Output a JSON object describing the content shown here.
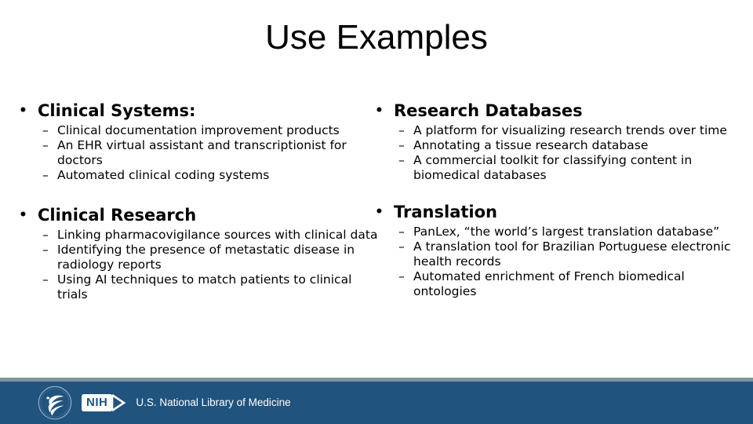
{
  "slide": {
    "title": "Use Examples",
    "background_color": "#ffffff",
    "text_color": "#000000"
  },
  "bullets": {
    "level1_marker": "•",
    "level2_marker": "–"
  },
  "left_column": {
    "groups": [
      {
        "heading": "Clinical Systems:",
        "items": [
          "Clinical documentation improvement products",
          "An EHR virtual assistant and transcriptionist for doctors",
          "Automated clinical coding systems"
        ]
      },
      {
        "heading": "Clinical Research",
        "items": [
          "Linking pharmacovigilance sources with clinical data",
          "Identifying the presence of metastatic disease in radiology reports",
          "Using AI techniques to match patients to clinical trials"
        ]
      }
    ]
  },
  "right_column": {
    "groups": [
      {
        "heading": "Research Databases",
        "items": [
          "A platform for visualizing research trends over time",
          "Annotating a tissue research database",
          "A commercial toolkit for classifying content in biomedical databases"
        ]
      },
      {
        "heading": "Translation",
        "items": [
          "PanLex, “the world’s largest translation database”",
          "A translation tool for Brazilian Portuguese electronic health records",
          "Automated enrichment of French biomedical ontologies"
        ]
      }
    ]
  },
  "footer": {
    "bar_color": "#21537f",
    "divider_color": "#7b93a3",
    "nih_badge_label": "NIH",
    "organization": "U.S. National Library of Medicine"
  }
}
